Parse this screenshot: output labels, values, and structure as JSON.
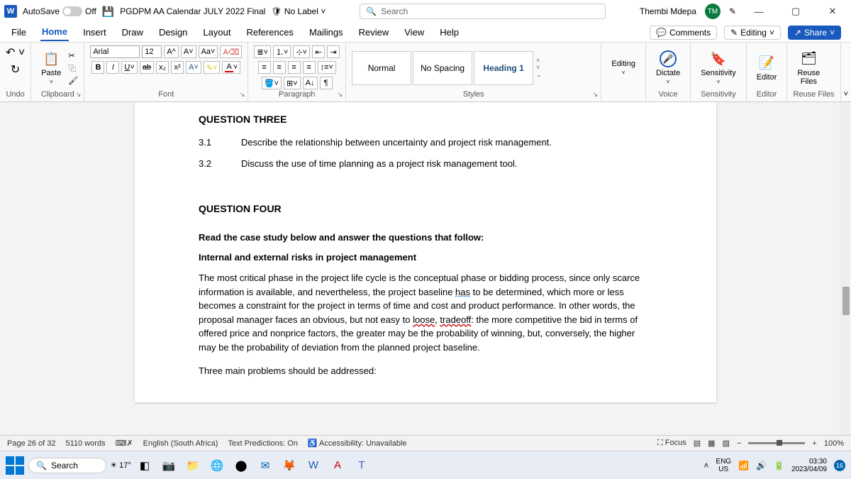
{
  "titlebar": {
    "autosave_label": "AutoSave",
    "autosave_state": "Off",
    "doc_title": "PGDPM AA Calendar JULY 2022 Final",
    "sensitivity": "No Label",
    "search_placeholder": "Search",
    "user_name": "Thembi Mdepa",
    "user_initials": "TM"
  },
  "tabs": {
    "items": [
      "File",
      "Home",
      "Insert",
      "Draw",
      "Design",
      "Layout",
      "References",
      "Mailings",
      "Review",
      "View",
      "Help"
    ],
    "comments": "Comments",
    "editing": "Editing",
    "share": "Share"
  },
  "ribbon": {
    "undo": "Undo",
    "paste": "Paste",
    "clipboard": "Clipboard",
    "font_name": "Arial",
    "font_size": "12",
    "font": "Font",
    "paragraph": "Paragraph",
    "styles_items": [
      "Normal",
      "No Spacing",
      "Heading 1"
    ],
    "styles": "Styles",
    "editing": "Editing",
    "dictate": "Dictate",
    "voice": "Voice",
    "sensitivity": "Sensitivity",
    "editor": "Editor",
    "reuse_files": "Reuse Files",
    "reuse_files_btn": "Reuse\nFiles"
  },
  "doc": {
    "q3_head": "QUESTION THREE",
    "q31_num": "3.1",
    "q31_text": "Describe the relationship between uncertainty and project risk management.",
    "q32_num": "3.2",
    "q32_text": "Discuss the use of time planning as a project risk management tool.",
    "q4_head": "QUESTION FOUR",
    "q4_sub1": "Read the case study below and answer the questions that follow:",
    "q4_sub2": "Internal and external risks in project management",
    "p1a": "The most critical phase in the project life cycle is the conceptual phase or bidding process, since only scarce information is available, and nevertheless, the project baseline ",
    "p1_has": "has",
    "p1_to": " to be determined, which more or less becomes a constraint for the project in terms of time and cost and product performance. In other words, the proposal manager faces an obvious, but not easy to ",
    "p1_loose": "loose",
    "p1b": ", ",
    "p1_tradeoff": "tradeoff",
    "p1c": ": the more competitive the bid in terms of offered price and nonprice factors, the greater may be the probability of winning, but, conversely, the higher may be the probability of deviation from the planned project baseline.",
    "p2": "Three main problems should be addressed:"
  },
  "status": {
    "page": "Page 26 of 32",
    "words": "5110 words",
    "lang": "English (South Africa)",
    "predictions": "Text Predictions: On",
    "accessibility": "Accessibility: Unavailable",
    "focus": "Focus",
    "zoom": "100%"
  },
  "taskbar": {
    "search": "Search",
    "temp": "17°",
    "lang1": "ENG",
    "lang2": "US",
    "time": "03:30",
    "date": "2023/04/09",
    "notif": "16"
  }
}
